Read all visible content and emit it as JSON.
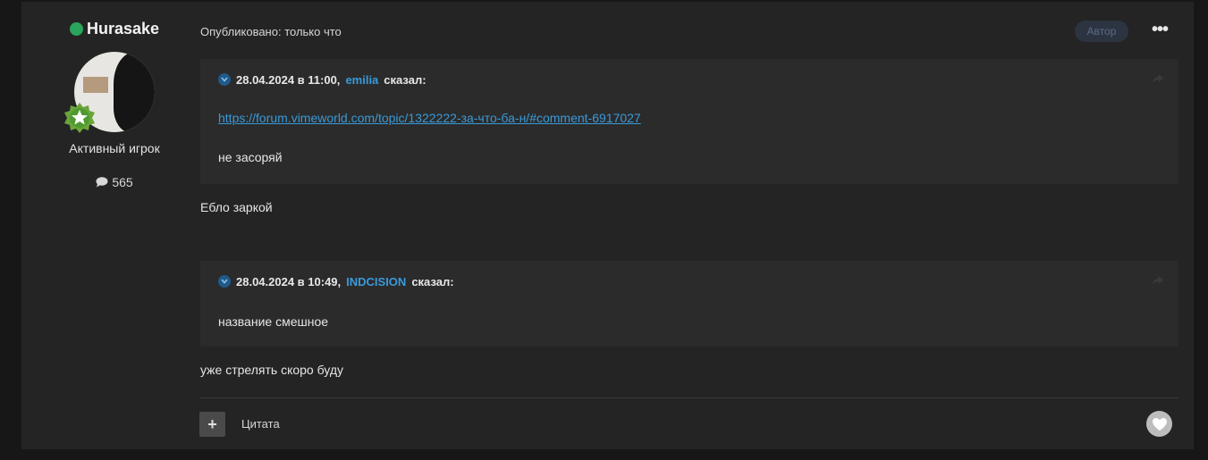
{
  "author": {
    "name": "Hurasake",
    "rank": "Активный игрок",
    "post_count": "565",
    "status_color": "#2aa55b",
    "avatar_icon": "user-avatar",
    "badge_icon": "star-rank-icon"
  },
  "meta": {
    "published": "Опубликовано: только что",
    "author_badge": "Автор",
    "more_icon": "ellipsis-icon"
  },
  "quotes": [
    {
      "date": "28.04.2024 в 11:00,",
      "user": "emilia",
      "said": "сказал:",
      "link": "https://forum.vimeworld.com/topic/1322222-за-что-ба-н/#comment-6917027",
      "text": "не засоряй"
    },
    {
      "date": "28.04.2024 в 10:49,",
      "user": "INDCISION",
      "said": "сказал:",
      "text": "название смешное"
    }
  ],
  "body": {
    "text1": "Ебло заркой",
    "text2": "уже стрелять скоро буду"
  },
  "footer": {
    "multiquote_icon": "plus-icon",
    "quote_label": "Цитата",
    "like_icon": "heart-icon"
  },
  "colors": {
    "background": "#171717",
    "post_bg": "#242424",
    "quote_bg": "#2b2b2b",
    "link": "#3a9ad9"
  }
}
